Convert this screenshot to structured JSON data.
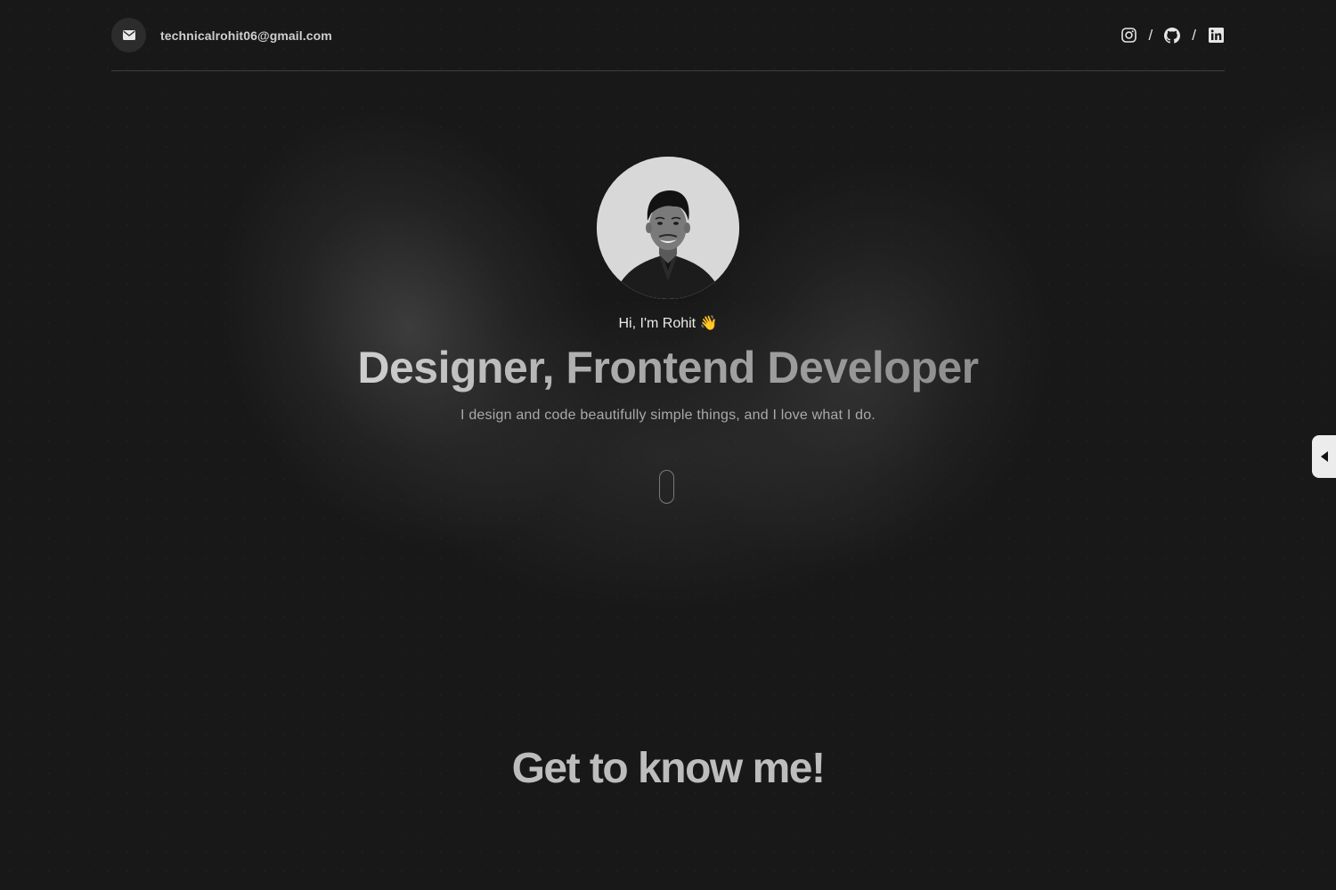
{
  "header": {
    "email": "technicalrohit06@gmail.com",
    "icons": {
      "mail": "mail-icon",
      "instagram": "instagram-icon",
      "github": "github-icon",
      "linkedin": "linkedin-icon"
    },
    "separator": "/"
  },
  "hero": {
    "greeting": "Hi, I'm Rohit 👋",
    "headline": "Designer, Frontend Developer",
    "tagline": "I design and code beautifully simple things, and I love what I do."
  },
  "about": {
    "title": "Get to know me!"
  },
  "colors": {
    "background": "#181818",
    "divider": "#3e3e3e",
    "toggle": "#ececec"
  }
}
